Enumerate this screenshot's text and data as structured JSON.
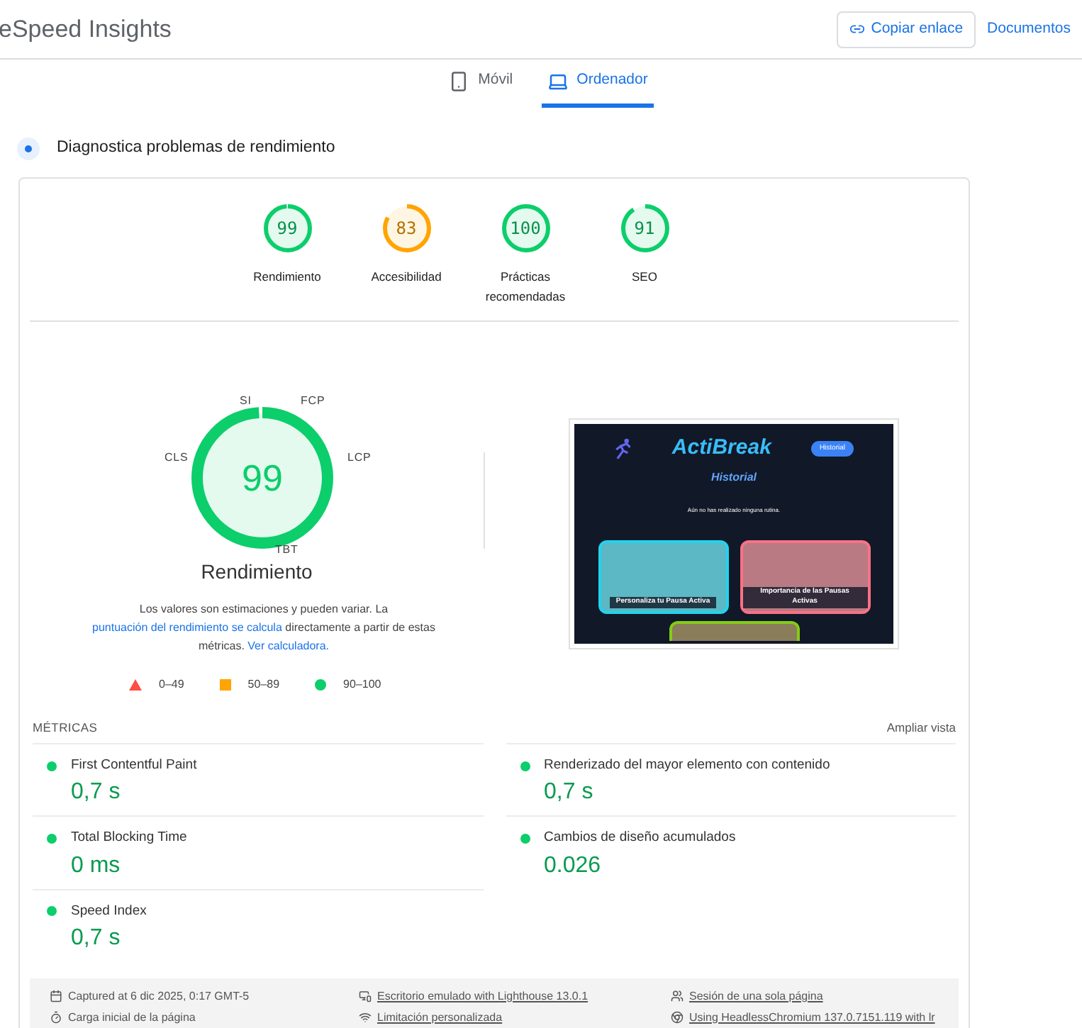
{
  "header": {
    "title": "eSpeed Insights",
    "copy_button": "Copiar enlace",
    "docs_link": "Documentos"
  },
  "tabs": [
    {
      "label": "Móvil",
      "kind": "phone",
      "selected": false
    },
    {
      "label": "Ordenador",
      "kind": "laptop",
      "selected": true
    }
  ],
  "diagnostics_title": "Diagnostica problemas de rendimiento",
  "categories": [
    {
      "score": "99",
      "label": "Rendimiento",
      "level": 0.99,
      "color": "#0cce6b"
    },
    {
      "score": "83",
      "label": "Accesibilidad",
      "level": 0.83,
      "color": "#ffa400"
    },
    {
      "score": "100",
      "label": "Prácticas recomendadas",
      "level": 1,
      "color": "#0cce6b"
    },
    {
      "score": "91",
      "label": "SEO",
      "level": 0.91,
      "color": "#0cce6b"
    }
  ],
  "performance": {
    "score": "99",
    "level": 0.99,
    "color": "#0cce6b",
    "title": "Rendimiento",
    "segment_labels": [
      "SI",
      "FCP",
      "LCP",
      "TBT",
      "CLS"
    ],
    "note": "Los valores son estimaciones y pueden variar. La ",
    "note_link": "puntuación del rendimiento se calcula",
    "note_mid": " directamente a partir de estas métricas. ",
    "note_link2": "Ver calculadora."
  },
  "legend": [
    {
      "kind": "triangle",
      "label": "0–49"
    },
    {
      "kind": "square",
      "label": "50–89"
    },
    {
      "kind": "circle",
      "label": "90–100"
    }
  ],
  "screenshot": {
    "app_title": "ActiBreak",
    "history_button": "Historial",
    "heading": "Historial",
    "message": "Aún no has realizado ninguna rutina.",
    "cards": [
      "Personaliza tu Pausa Activa",
      "Importancia de las Pausas Activas"
    ]
  },
  "metrics": {
    "title": "MÉTRICAS",
    "expand": "Ampliar vista",
    "items": [
      {
        "name": "First Contentful Paint",
        "value": "0,7 s",
        "color": "#0cce6b"
      },
      {
        "name": "Renderizado del mayor elemento con contenido",
        "value": "0,7 s",
        "color": "#0cce6b"
      },
      {
        "name": "Total Blocking Time",
        "value": "0 ms",
        "color": "#0cce6b"
      },
      {
        "name": "Cambios de diseño acumulados",
        "value": "0.026",
        "color": "#0cce6b"
      },
      {
        "name": "Speed Index",
        "value": "0,7 s",
        "color": "#0cce6b"
      }
    ]
  },
  "footer": [
    {
      "kind": "calendar",
      "text": "Captured at 6 dic 2025, 0:17 GMT-5",
      "link": false
    },
    {
      "kind": "devices",
      "text": "Escritorio emulado with Lighthouse 13.0.1",
      "link": true
    },
    {
      "kind": "users",
      "text": "Sesión de una sola página",
      "link": true
    },
    {
      "kind": "timer",
      "text": "Carga inicial de la página",
      "link": false
    },
    {
      "kind": "wifi",
      "text": "Limitación personalizada",
      "link": true
    },
    {
      "kind": "chrome",
      "text": "Using HeadlessChromium 137.0.7151.119 with lr",
      "link": true
    }
  ]
}
